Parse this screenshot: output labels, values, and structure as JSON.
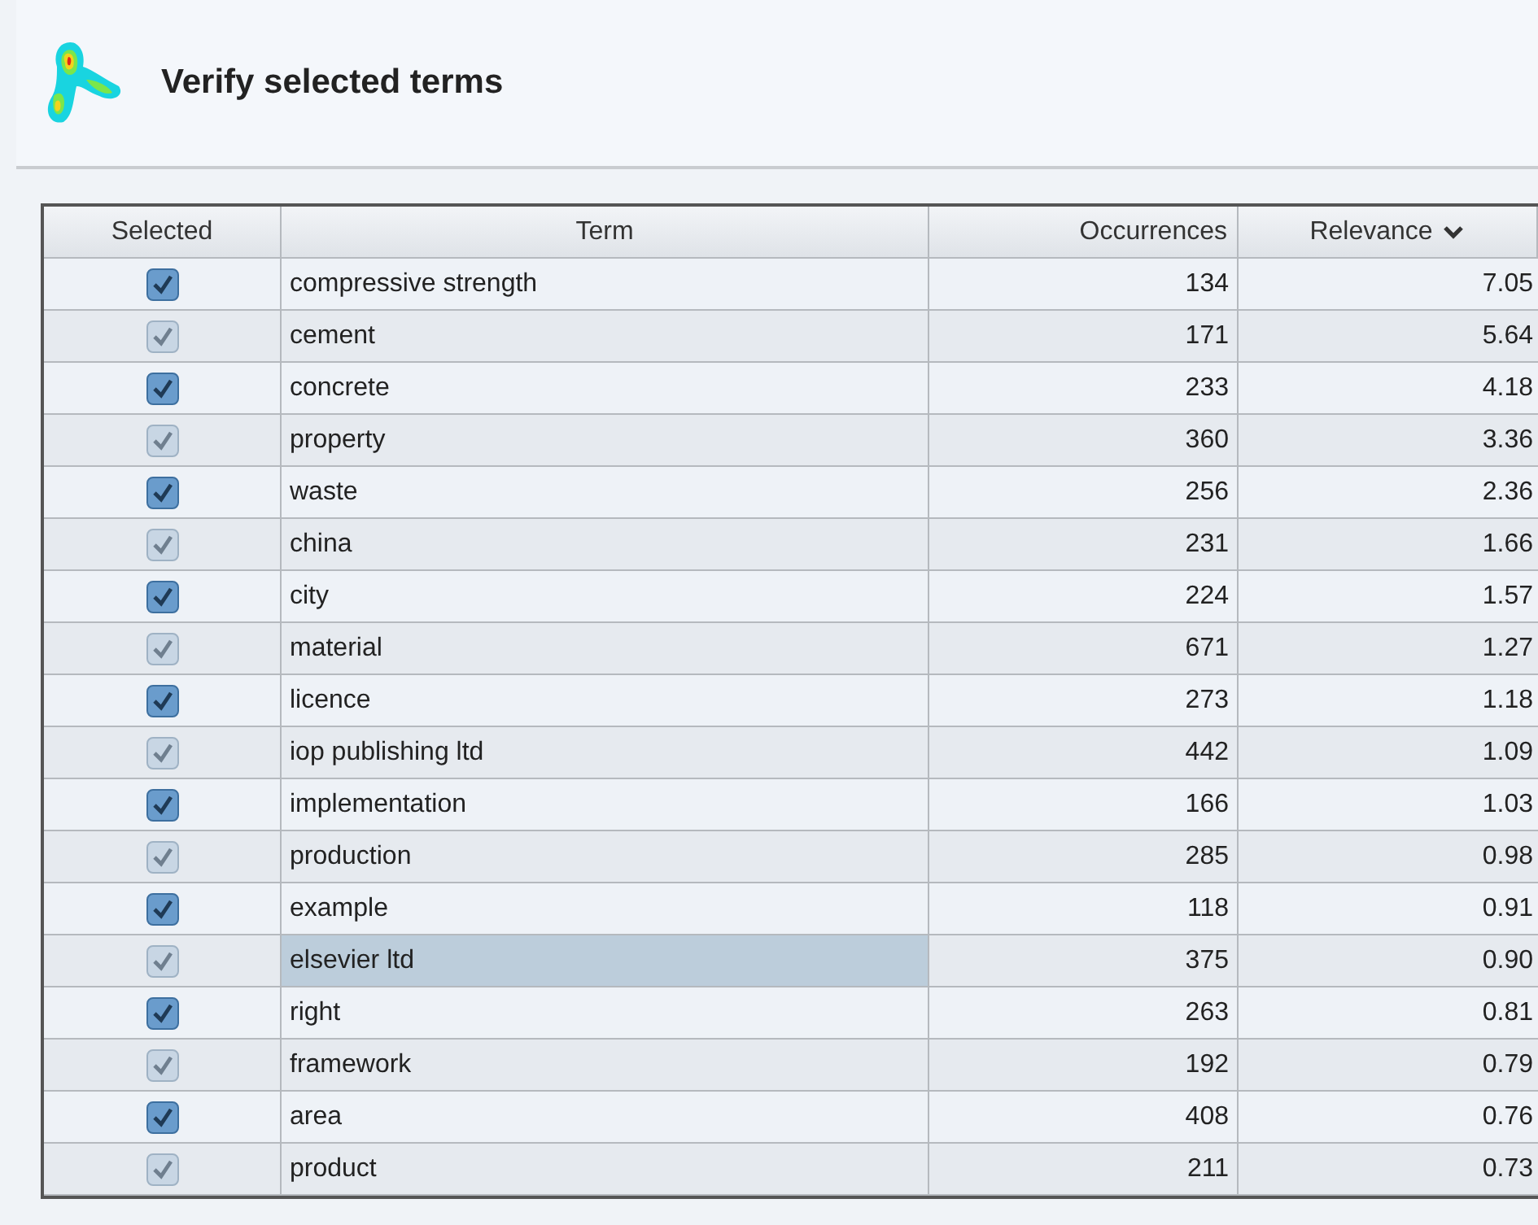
{
  "title": "Verify selected terms",
  "table": {
    "columns": [
      {
        "label": "Selected"
      },
      {
        "label": "Term"
      },
      {
        "label": "Occurrences"
      },
      {
        "label": "Relevance",
        "sorted": true
      }
    ],
    "rows": [
      {
        "checked": true,
        "term": "compressive strength",
        "occurrences": "134",
        "relevance": "7.05",
        "selected": false
      },
      {
        "checked": true,
        "term": "cement",
        "occurrences": "171",
        "relevance": "5.64",
        "selected": false
      },
      {
        "checked": true,
        "term": "concrete",
        "occurrences": "233",
        "relevance": "4.18",
        "selected": false
      },
      {
        "checked": true,
        "term": "property",
        "occurrences": "360",
        "relevance": "3.36",
        "selected": false
      },
      {
        "checked": true,
        "term": "waste",
        "occurrences": "256",
        "relevance": "2.36",
        "selected": false
      },
      {
        "checked": true,
        "term": "china",
        "occurrences": "231",
        "relevance": "1.66",
        "selected": false
      },
      {
        "checked": true,
        "term": "city",
        "occurrences": "224",
        "relevance": "1.57",
        "selected": false
      },
      {
        "checked": true,
        "term": "material",
        "occurrences": "671",
        "relevance": "1.27",
        "selected": false
      },
      {
        "checked": true,
        "term": "licence",
        "occurrences": "273",
        "relevance": "1.18",
        "selected": false
      },
      {
        "checked": true,
        "term": "iop publishing ltd",
        "occurrences": "442",
        "relevance": "1.09",
        "selected": false
      },
      {
        "checked": true,
        "term": "implementation",
        "occurrences": "166",
        "relevance": "1.03",
        "selected": false
      },
      {
        "checked": true,
        "term": "production",
        "occurrences": "285",
        "relevance": "0.98",
        "selected": false
      },
      {
        "checked": true,
        "term": "example",
        "occurrences": "118",
        "relevance": "0.91",
        "selected": false
      },
      {
        "checked": true,
        "term": "elsevier ltd",
        "occurrences": "375",
        "relevance": "0.90",
        "selected": true
      },
      {
        "checked": true,
        "term": "right",
        "occurrences": "263",
        "relevance": "0.81",
        "selected": false
      },
      {
        "checked": true,
        "term": "framework",
        "occurrences": "192",
        "relevance": "0.79",
        "selected": false
      },
      {
        "checked": true,
        "term": "area",
        "occurrences": "408",
        "relevance": "0.76",
        "selected": false
      },
      {
        "checked": true,
        "term": "product",
        "occurrences": "211",
        "relevance": "0.73",
        "selected": false
      }
    ]
  }
}
